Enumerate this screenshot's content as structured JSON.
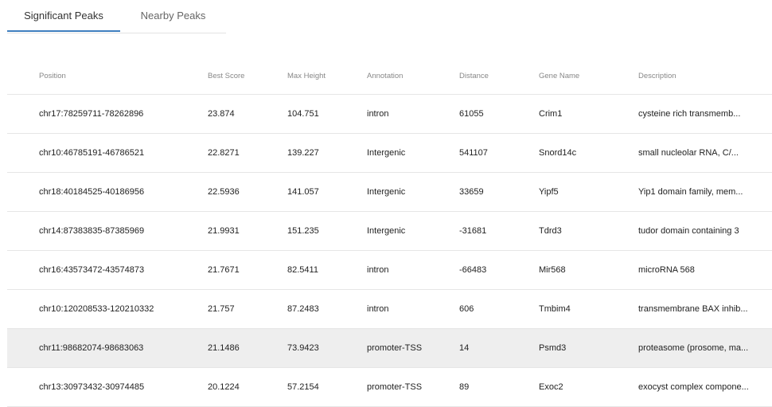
{
  "tabs": [
    {
      "label": "Significant Peaks",
      "active": true
    },
    {
      "label": "Nearby Peaks",
      "active": false
    }
  ],
  "columns": [
    "Position",
    "Best Score",
    "Max Height",
    "Annotation",
    "Distance",
    "Gene Name",
    "Description"
  ],
  "rows": [
    [
      "chr17:78259711-78262896",
      "23.874",
      "104.751",
      "intron",
      "61055",
      "Crim1",
      "cysteine rich transmemb..."
    ],
    [
      "chr10:46785191-46786521",
      "22.8271",
      "139.227",
      "Intergenic",
      "541107",
      "Snord14c",
      "small nucleolar RNA, C/..."
    ],
    [
      "chr18:40184525-40186956",
      "22.5936",
      "141.057",
      "Intergenic",
      "33659",
      "Yipf5",
      "Yip1 domain family, mem..."
    ],
    [
      "chr14:87383835-87385969",
      "21.9931",
      "151.235",
      "Intergenic",
      "-31681",
      "Tdrd3",
      "tudor domain containing 3"
    ],
    [
      "chr16:43573472-43574873",
      "21.7671",
      "82.5411",
      "intron",
      "-66483",
      "Mir568",
      "microRNA 568"
    ],
    [
      "chr10:120208533-120210332",
      "21.757",
      "87.2483",
      "intron",
      "606",
      "Tmbim4",
      "transmembrane BAX inhib..."
    ],
    [
      "chr11:98682074-98683063",
      "21.1486",
      "73.9423",
      "promoter-TSS",
      "14",
      "Psmd3",
      "proteasome (prosome, ma..."
    ],
    [
      "chr13:30973432-30974485",
      "20.1224",
      "57.2154",
      "promoter-TSS",
      "89",
      "Exoc2",
      "exocyst complex compone..."
    ]
  ],
  "highlighted_row_index": 6,
  "colors": {
    "active_tab_underline": "#3f7fbf",
    "row_highlight": "#eeeeee"
  }
}
